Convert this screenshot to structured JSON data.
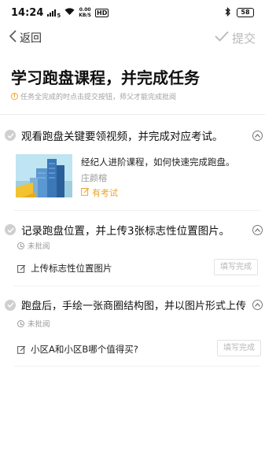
{
  "status_bar": {
    "time": "14:24",
    "signal": "5",
    "net_speed_value": "0.00",
    "net_speed_unit": "KB/S",
    "hd": "HD",
    "battery": "58"
  },
  "nav": {
    "back_label": "返回",
    "submit_label": "提交"
  },
  "header": {
    "title": "学习跑盘课程，并完成任务",
    "notice": "任务全完成的时点击提交按钮，师父才能完成批阅"
  },
  "tasks": [
    {
      "title": "观看跑盘关键要领视频，并完成对应考试。",
      "course": {
        "description": "经纪人进阶课程，如何快速完成跑盘。",
        "author": "庄颜榕",
        "exam_label": "有考试"
      }
    },
    {
      "title": "记录跑盘位置，并上传3张标志性位置图片。",
      "status": "未批阅",
      "item_label": "上传标志性位置图片",
      "button_label": "填写完成"
    },
    {
      "title": "跑盘后，手绘一张商圈结构图，并以图片形式上传",
      "status": "未批阅",
      "item_label": "小区A和小区B哪个值得买?",
      "button_label": "填写完成"
    }
  ],
  "colors": {
    "accent_orange": "#e9a52b",
    "disabled_gray": "#b8b8b8"
  }
}
